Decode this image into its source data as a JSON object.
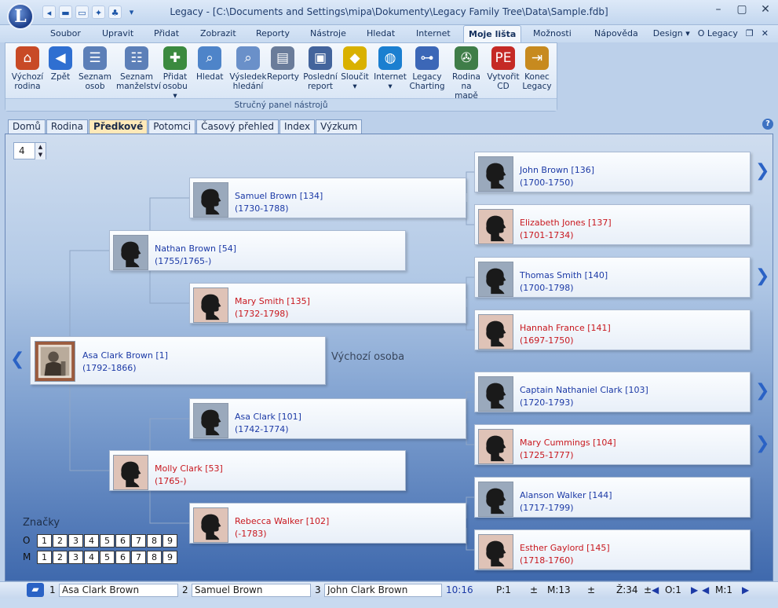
{
  "app": {
    "logo_letter": "L",
    "title": "Legacy - [C:\\Documents and Settings\\mipa\\Dokumenty\\Legacy Family Tree\\Data\\Sample.fdb]"
  },
  "quick_access": [
    "back-icon",
    "folder-icon",
    "print-icon",
    "tools-icon",
    "tree-icon"
  ],
  "window_controls": {
    "minimize": "–",
    "maximize": "▢",
    "close": "✕"
  },
  "menu": {
    "tabs": [
      "Soubor",
      "Upravit",
      "Přidat",
      "Zobrazit",
      "Reporty",
      "Nástroje",
      "Hledat",
      "Internet",
      "Moje lišta",
      "Možnosti",
      "Nápověda"
    ],
    "active": "Moje lišta",
    "right": {
      "design": "Design ▾",
      "about": "O Legacy",
      "restore": "❐",
      "close": "✕"
    }
  },
  "ribbon": {
    "group_label": "Stručný panel nástrojů",
    "buttons": [
      {
        "id": "home",
        "label": "Výchozí\nrodina",
        "icon": "house-icon",
        "glyph": "⌂",
        "color": "#c84a26"
      },
      {
        "id": "back",
        "label": "Zpět",
        "icon": "back-arrow-icon",
        "glyph": "◀",
        "color": "#2f6fd1"
      },
      {
        "id": "list",
        "label": "Seznam\nosob",
        "icon": "list-icon",
        "glyph": "☰",
        "color": "#5c7fb8"
      },
      {
        "id": "spouses",
        "label": "Seznam\nmanželství",
        "icon": "marriage-list-icon",
        "glyph": "☷",
        "color": "#5c7fb8"
      },
      {
        "id": "add",
        "label": "Přidat\nosobu ▾",
        "icon": "add-person-icon",
        "glyph": "✚",
        "color": "#3b8a3f"
      },
      {
        "id": "search",
        "label": "Hledat",
        "icon": "search-icon",
        "glyph": "⌕",
        "color": "#4e84c9"
      },
      {
        "id": "results",
        "label": "Výsledek\nhledání",
        "icon": "search-results-icon",
        "glyph": "⌕",
        "color": "#6a90c9"
      },
      {
        "id": "reports",
        "label": "Reporty",
        "icon": "report-icon",
        "glyph": "▤",
        "color": "#6a7c9a"
      },
      {
        "id": "lastreport",
        "label": "Poslední\nreport",
        "icon": "last-report-icon",
        "glyph": "▣",
        "color": "#43649c"
      },
      {
        "id": "merge",
        "label": "Sloučit\n▾",
        "icon": "merge-icon",
        "glyph": "◆",
        "color": "#d9b100"
      },
      {
        "id": "internet",
        "label": "Internet\n▾",
        "icon": "globe-icon",
        "glyph": "◍",
        "color": "#1b7fd0"
      },
      {
        "id": "charting",
        "label": "Legacy\nCharting",
        "icon": "chart-tree-icon",
        "glyph": "⊶",
        "color": "#3c67b7"
      },
      {
        "id": "map",
        "label": "Rodina\nna mapě",
        "icon": "map-icon",
        "glyph": "✇",
        "color": "#3f7d48"
      },
      {
        "id": "cd",
        "label": "Vytvořit\nCD",
        "icon": "cd-icon",
        "glyph": "PE",
        "color": "#c52a25"
      },
      {
        "id": "exit",
        "label": "Konec\nLegacy",
        "icon": "exit-door-icon",
        "glyph": "⇥",
        "color": "#c78a1f"
      }
    ]
  },
  "view_tabs": [
    "Domů",
    "Rodina",
    "Předkové",
    "Potomci",
    "Časový přehled",
    "Index",
    "Výzkum"
  ],
  "active_view_tab": "Předkové",
  "generations": "4",
  "home_person_label": "Výchozí osoba",
  "persons": [
    {
      "id": "p1",
      "name": "Asa Clark Brown [1]",
      "dates": "(1792-1866)",
      "sex": "m",
      "photo": true
    },
    {
      "id": "p54",
      "name": "Nathan Brown [54]",
      "dates": "(1755/1765-)",
      "sex": "m"
    },
    {
      "id": "p53",
      "name": "Molly Clark [53]",
      "dates": "(1765-)",
      "sex": "f"
    },
    {
      "id": "p134",
      "name": "Samuel Brown [134]",
      "dates": "(1730-1788)",
      "sex": "m"
    },
    {
      "id": "p135",
      "name": "Mary Smith [135]",
      "dates": "(1732-1798)",
      "sex": "f"
    },
    {
      "id": "p101",
      "name": "Asa Clark [101]",
      "dates": "(1742-1774)",
      "sex": "m"
    },
    {
      "id": "p102",
      "name": "Rebecca Walker [102]",
      "dates": "(-1783)",
      "sex": "f"
    },
    {
      "id": "p136",
      "name": "John Brown [136]",
      "dates": "(1700-1750)",
      "sex": "m",
      "more": true
    },
    {
      "id": "p137",
      "name": "Elizabeth Jones [137]",
      "dates": "(1701-1734)",
      "sex": "f"
    },
    {
      "id": "p140",
      "name": "Thomas Smith [140]",
      "dates": "(1700-1798)",
      "sex": "m",
      "more": true
    },
    {
      "id": "p141",
      "name": "Hannah France [141]",
      "dates": "(1697-1750)",
      "sex": "f"
    },
    {
      "id": "p103",
      "name": "Captain Nathaniel Clark [103]",
      "dates": "(1720-1793)",
      "sex": "m",
      "more": true
    },
    {
      "id": "p104",
      "name": "Mary Cummings [104]",
      "dates": "(1725-1777)",
      "sex": "f",
      "more": true
    },
    {
      "id": "p144",
      "name": "Alanson Walker [144]",
      "dates": "(1717-1799)",
      "sex": "m"
    },
    {
      "id": "p145",
      "name": "Esther Gaylord [145]",
      "dates": "(1718-1760)",
      "sex": "f"
    }
  ],
  "tags": {
    "label": "Značky",
    "rows": [
      "O",
      "M"
    ],
    "cells": [
      "1",
      "2",
      "3",
      "4",
      "5",
      "6",
      "7",
      "8",
      "9"
    ]
  },
  "statusbar": {
    "slot1_num": "1",
    "slot1_name": "Asa Clark Brown",
    "slot2_num": "2",
    "slot2_name": "Samuel Brown",
    "slot3_num": "3",
    "slot3_name": "John Clark Brown",
    "time": "10:16",
    "p": "P:1",
    "m": "M:13",
    "z": "Ž:34",
    "o": "O:1",
    "mm": "M:1"
  },
  "colors": {
    "male_text": "#1c3aa6",
    "female_text": "#c8171e",
    "accent": "#2a62c5"
  }
}
